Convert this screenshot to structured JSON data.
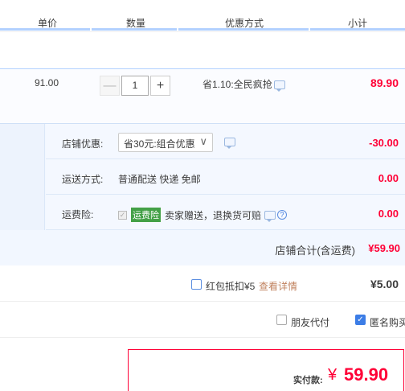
{
  "header": {
    "col_unit_price": "单价",
    "col_quantity": "数量",
    "col_promo": "优惠方式",
    "col_subtotal": "小计"
  },
  "item": {
    "price": "91.00",
    "quantity": "1",
    "minus_label": "—",
    "plus_label": "+",
    "promo": "省1.10:全民疯抢",
    "subtotal": "89.90"
  },
  "shop_discount": {
    "label": "店铺优惠:",
    "selected": "省30元:组合优惠",
    "value": "-30.00"
  },
  "shipping": {
    "label": "运送方式:",
    "method": "普通配送 快递 免邮",
    "value": "0.00"
  },
  "insurance": {
    "label": "运费险:",
    "tag": "运费险",
    "desc": "卖家赠送，退换货可赔",
    "value": "0.00"
  },
  "shop_total": {
    "label": "店铺合计(含运费)",
    "amount": "¥59.90"
  },
  "red_packet": {
    "label": "红包抵扣¥5",
    "link": "查看详情",
    "amount": "¥5.00"
  },
  "options": {
    "friend_pay": "朋友代付",
    "anonymous": "匿名购买"
  },
  "payment": {
    "label": "实付款:",
    "currency": "¥",
    "amount": "59.90"
  },
  "colors": {
    "accent_red": "#ff0036",
    "accent_blue": "#3c7de6",
    "panel_blue": "#f2f7ff"
  }
}
